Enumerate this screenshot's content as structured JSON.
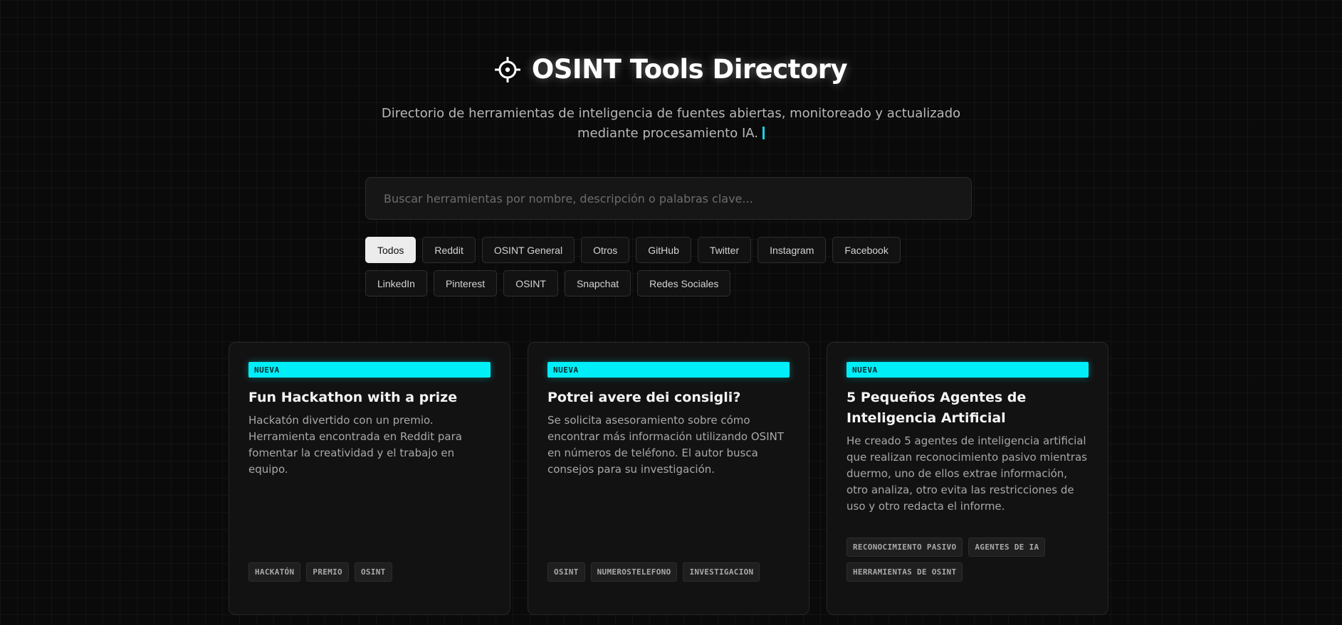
{
  "header": {
    "icon": "crosshair-icon",
    "title": "OSINT Tools Directory",
    "subtitle_line1": "Directorio de herramientas de inteligencia de fuentes abiertas, monitoreado y actualizado",
    "subtitle_line2": "mediante procesamiento IA."
  },
  "search": {
    "placeholder": "Buscar herramientas por nombre, descripción o palabras clave...",
    "value": ""
  },
  "filters": [
    {
      "label": "Todos",
      "active": true
    },
    {
      "label": "Reddit",
      "active": false
    },
    {
      "label": "OSINT General",
      "active": false
    },
    {
      "label": "Otros",
      "active": false
    },
    {
      "label": "GitHub",
      "active": false
    },
    {
      "label": "Twitter",
      "active": false
    },
    {
      "label": "Instagram",
      "active": false
    },
    {
      "label": "Facebook",
      "active": false
    },
    {
      "label": "LinkedIn",
      "active": false
    },
    {
      "label": "Pinterest",
      "active": false
    },
    {
      "label": "OSINT",
      "active": false
    },
    {
      "label": "Snapchat",
      "active": false
    },
    {
      "label": "Redes Sociales",
      "active": false
    }
  ],
  "cards": [
    {
      "badge": "NUEVA",
      "title": "Fun Hackathon with a prize",
      "description": "Hackatón divertido con un premio. Herramienta encontrada en Reddit para fomentar la creatividad y el trabajo en equipo.",
      "tags": [
        "HACKATÓN",
        "PREMIO",
        "OSINT"
      ]
    },
    {
      "badge": "NUEVA",
      "title": "Potrei avere dei consigli?",
      "description": "Se solicita asesoramiento sobre cómo encontrar más información utilizando OSINT en números de teléfono. El autor busca consejos para su investigación.",
      "tags": [
        "OSINT",
        "NUMEROSTELEFONO",
        "INVESTIGACION"
      ]
    },
    {
      "badge": "NUEVA",
      "title": "5 Pequeños Agentes de Inteligencia Artificial",
      "description": "He creado 5 agentes de inteligencia artificial que realizan reconocimiento pasivo mientras duermo, uno de ellos extrae información, otro analiza, otro evita las restricciones de uso y otro redacta el informe.",
      "tags": [
        "RECONOCIMIENTO PASIVO",
        "AGENTES DE IA",
        "HERRAMIENTAS DE OSINT"
      ]
    }
  ],
  "colors": {
    "background": "#0a0a0a",
    "accent": "#00eef7",
    "cursor": "#19d3e6"
  }
}
